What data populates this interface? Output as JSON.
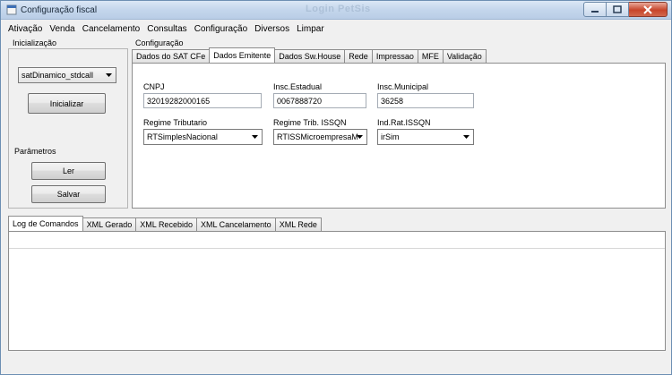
{
  "window": {
    "title": "Configuração fiscal",
    "faded_title": "Login PetSis"
  },
  "menu": [
    "Ativação",
    "Venda",
    "Cancelamento",
    "Consultas",
    "Configuração",
    "Diversos",
    "Limpar"
  ],
  "init": {
    "group_label": "Inicialização",
    "dll_select": "satDinamico_stdcall",
    "init_button": "Inicializar"
  },
  "params": {
    "group_label": "Parâmetros",
    "read_button": "Ler",
    "save_button": "Salvar"
  },
  "config": {
    "group_label": "Configuração",
    "tabs": [
      "Dados do SAT CFe",
      "Dados Emitente",
      "Dados Sw.House",
      "Rede",
      "Impressao",
      "MFE",
      "Validação"
    ],
    "active_tab": "Dados Emitente"
  },
  "emitente": {
    "cnpj_label": "CNPJ",
    "cnpj_value": "32019282000165",
    "ie_label": "Insc.Estadual",
    "ie_value": "0067888720",
    "im_label": "Insc.Municipal",
    "im_value": "36258",
    "regime_label": "Regime Tributario",
    "regime_value": "RTSimplesNacional",
    "regime_issqn_label": "Regime Trib. ISSQN",
    "regime_issqn_value": "RTISSMicroempresaM",
    "ind_rat_label": "Ind.Rat.ISSQN",
    "ind_rat_value": "irSim"
  },
  "log_tabs": [
    "Log de Comandos",
    "XML Gerado",
    "XML Recebido",
    "XML Cancelamento",
    "XML Rede"
  ],
  "active_log_tab": "Log de Comandos"
}
